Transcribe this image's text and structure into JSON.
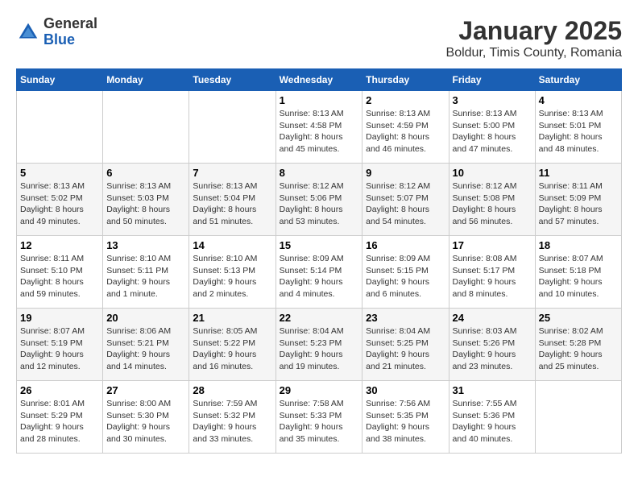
{
  "header": {
    "logo_general": "General",
    "logo_blue": "Blue",
    "month_title": "January 2025",
    "location": "Boldur, Timis County, Romania"
  },
  "calendar": {
    "days_of_week": [
      "Sunday",
      "Monday",
      "Tuesday",
      "Wednesday",
      "Thursday",
      "Friday",
      "Saturday"
    ],
    "weeks": [
      [
        {
          "day": "",
          "info": ""
        },
        {
          "day": "",
          "info": ""
        },
        {
          "day": "",
          "info": ""
        },
        {
          "day": "1",
          "info": "Sunrise: 8:13 AM\nSunset: 4:58 PM\nDaylight: 8 hours\nand 45 minutes."
        },
        {
          "day": "2",
          "info": "Sunrise: 8:13 AM\nSunset: 4:59 PM\nDaylight: 8 hours\nand 46 minutes."
        },
        {
          "day": "3",
          "info": "Sunrise: 8:13 AM\nSunset: 5:00 PM\nDaylight: 8 hours\nand 47 minutes."
        },
        {
          "day": "4",
          "info": "Sunrise: 8:13 AM\nSunset: 5:01 PM\nDaylight: 8 hours\nand 48 minutes."
        }
      ],
      [
        {
          "day": "5",
          "info": "Sunrise: 8:13 AM\nSunset: 5:02 PM\nDaylight: 8 hours\nand 49 minutes."
        },
        {
          "day": "6",
          "info": "Sunrise: 8:13 AM\nSunset: 5:03 PM\nDaylight: 8 hours\nand 50 minutes."
        },
        {
          "day": "7",
          "info": "Sunrise: 8:13 AM\nSunset: 5:04 PM\nDaylight: 8 hours\nand 51 minutes."
        },
        {
          "day": "8",
          "info": "Sunrise: 8:12 AM\nSunset: 5:06 PM\nDaylight: 8 hours\nand 53 minutes."
        },
        {
          "day": "9",
          "info": "Sunrise: 8:12 AM\nSunset: 5:07 PM\nDaylight: 8 hours\nand 54 minutes."
        },
        {
          "day": "10",
          "info": "Sunrise: 8:12 AM\nSunset: 5:08 PM\nDaylight: 8 hours\nand 56 minutes."
        },
        {
          "day": "11",
          "info": "Sunrise: 8:11 AM\nSunset: 5:09 PM\nDaylight: 8 hours\nand 57 minutes."
        }
      ],
      [
        {
          "day": "12",
          "info": "Sunrise: 8:11 AM\nSunset: 5:10 PM\nDaylight: 8 hours\nand 59 minutes."
        },
        {
          "day": "13",
          "info": "Sunrise: 8:10 AM\nSunset: 5:11 PM\nDaylight: 9 hours\nand 1 minute."
        },
        {
          "day": "14",
          "info": "Sunrise: 8:10 AM\nSunset: 5:13 PM\nDaylight: 9 hours\nand 2 minutes."
        },
        {
          "day": "15",
          "info": "Sunrise: 8:09 AM\nSunset: 5:14 PM\nDaylight: 9 hours\nand 4 minutes."
        },
        {
          "day": "16",
          "info": "Sunrise: 8:09 AM\nSunset: 5:15 PM\nDaylight: 9 hours\nand 6 minutes."
        },
        {
          "day": "17",
          "info": "Sunrise: 8:08 AM\nSunset: 5:17 PM\nDaylight: 9 hours\nand 8 minutes."
        },
        {
          "day": "18",
          "info": "Sunrise: 8:07 AM\nSunset: 5:18 PM\nDaylight: 9 hours\nand 10 minutes."
        }
      ],
      [
        {
          "day": "19",
          "info": "Sunrise: 8:07 AM\nSunset: 5:19 PM\nDaylight: 9 hours\nand 12 minutes."
        },
        {
          "day": "20",
          "info": "Sunrise: 8:06 AM\nSunset: 5:21 PM\nDaylight: 9 hours\nand 14 minutes."
        },
        {
          "day": "21",
          "info": "Sunrise: 8:05 AM\nSunset: 5:22 PM\nDaylight: 9 hours\nand 16 minutes."
        },
        {
          "day": "22",
          "info": "Sunrise: 8:04 AM\nSunset: 5:23 PM\nDaylight: 9 hours\nand 19 minutes."
        },
        {
          "day": "23",
          "info": "Sunrise: 8:04 AM\nSunset: 5:25 PM\nDaylight: 9 hours\nand 21 minutes."
        },
        {
          "day": "24",
          "info": "Sunrise: 8:03 AM\nSunset: 5:26 PM\nDaylight: 9 hours\nand 23 minutes."
        },
        {
          "day": "25",
          "info": "Sunrise: 8:02 AM\nSunset: 5:28 PM\nDaylight: 9 hours\nand 25 minutes."
        }
      ],
      [
        {
          "day": "26",
          "info": "Sunrise: 8:01 AM\nSunset: 5:29 PM\nDaylight: 9 hours\nand 28 minutes."
        },
        {
          "day": "27",
          "info": "Sunrise: 8:00 AM\nSunset: 5:30 PM\nDaylight: 9 hours\nand 30 minutes."
        },
        {
          "day": "28",
          "info": "Sunrise: 7:59 AM\nSunset: 5:32 PM\nDaylight: 9 hours\nand 33 minutes."
        },
        {
          "day": "29",
          "info": "Sunrise: 7:58 AM\nSunset: 5:33 PM\nDaylight: 9 hours\nand 35 minutes."
        },
        {
          "day": "30",
          "info": "Sunrise: 7:56 AM\nSunset: 5:35 PM\nDaylight: 9 hours\nand 38 minutes."
        },
        {
          "day": "31",
          "info": "Sunrise: 7:55 AM\nSunset: 5:36 PM\nDaylight: 9 hours\nand 40 minutes."
        },
        {
          "day": "",
          "info": ""
        }
      ]
    ]
  }
}
